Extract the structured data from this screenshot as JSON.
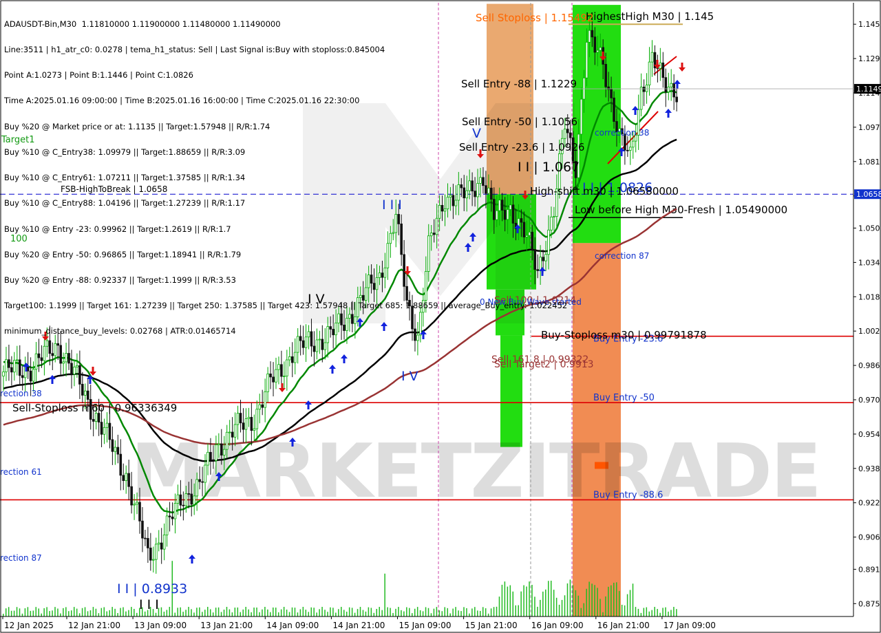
{
  "info_lines": [
    "ADAUSDT-Bin,M30  1.11810000 1.11900000 1.11480000 1.11490000",
    "Line:3511 | h1_atr_c0: 0.0278 | tema_h1_status: Sell | Last Signal is:Buy with stoploss:0.845004",
    "Point A:1.0273 | Point B:1.1446 | Point C:1.0826",
    "Time A:2025.01.16 09:00:00 | Time B:2025.01.16 16:00:00 | Time C:2025.01.16 22:30:00",
    "Buy %20 @ Market price or at: 1.1135 || Target:1.57948 || R/R:1.74",
    "Buy %10 @ C_Entry38: 1.09979 || Target:1.88659 || R/R:3.09",
    "Buy %10 @ C_Entry61: 1.07211 || Target:1.37585 || R/R:1.34",
    "Buy %10 @ C_Entry88: 1.04196 || Target:1.27239 || R/R:1.17",
    "Buy %10 @ Entry -23: 0.99962 || Target:1.2619 || R/R:1.7",
    "Buy %20 @ Entry -50: 0.96865 || Target:1.18941 || R/R:1.79",
    "Buy %20 @ Entry -88: 0.92337 || Target:1.1999 || R/R:3.53",
    "Target100: 1.1999 || Target 161: 1.27239 || Target 250: 1.37585 || Target 423: 1.57948 || Target 685: 1.88659 || average_Buy_entry: 1.022452",
    "minimum_distance_buy_levels: 0.02768 | ATR:0.01465714"
  ],
  "watermark": "MARKETZITRADE",
  "colors": {
    "up_candle": "#00aa00",
    "down_candle": "#111111",
    "ema_green": "#008800",
    "ema_black": "#000000",
    "ema_brown": "#993333",
    "line_red": "#dd0000",
    "fsb_blue": "#0000cc",
    "zone_green": "#22dd11",
    "zone_orange": "#f08040",
    "text_orange": "#ff6600"
  },
  "chart_data": {
    "type": "candlestick",
    "symbol": "ADAUSDT-Bin",
    "timeframe": "M30",
    "ylim": [
      0.869,
      1.155
    ],
    "yticks": [
      1.145,
      1.129,
      1.113,
      1.097,
      1.081,
      1.065,
      1.05,
      1.034,
      1.018,
      1.002,
      0.986,
      0.97,
      0.954,
      0.938,
      0.922,
      0.906,
      0.891,
      0.875
    ],
    "ytick_labels": [
      "1.145",
      "1.129",
      "1.114",
      "1.097",
      "1.081",
      "1.065",
      "1.050",
      "1.034",
      "1.018",
      "1.002",
      "0.986",
      "0.970",
      "0.954",
      "0.938",
      "0.922",
      "0.906",
      "0.891",
      "0.875"
    ],
    "current_price": 1.1149,
    "current_price_label": "1.1149",
    "fsb_price_label": "1.0658",
    "x_labels": [
      "12 Jan 2025",
      "12 Jan 21:00",
      "13 Jan 09:00",
      "13 Jan 21:00",
      "14 Jan 09:00",
      "14 Jan 21:00",
      "15 Jan 09:00",
      "15 Jan 21:00",
      "16 Jan 09:00",
      "16 Jan 21:00",
      "17 Jan 09:00"
    ],
    "horizontal_lines": [
      {
        "name": "FSB-HighToBreak",
        "price": 1.0658,
        "style": "dashed-blue",
        "label": "FSB-HighToBreak | 1.0658"
      },
      {
        "name": "Buy Entry -23.6",
        "price": 0.9996,
        "style": "red",
        "label": "Buy Entry -23.6"
      },
      {
        "name": "Buy Entry -50",
        "price": 0.96865,
        "style": "red",
        "label": "Buy Entry -50"
      },
      {
        "name": "Buy Entry -88.6",
        "price": 0.92337,
        "style": "red",
        "label": "Buy Entry -88.6"
      },
      {
        "name": "HighestHigh M30",
        "price": 1.145,
        "style": "olive",
        "label": "HighestHigh   M30 | 1.145"
      },
      {
        "name": "Low before High M30-Fresh",
        "price": 1.0549,
        "style": "black",
        "label": "Low before High   M30-Fresh | 1.05490000"
      }
    ],
    "annotations": [
      "Sell Stoploss | 1.15492",
      "Sell Entry -88 | 1.1229",
      "Sell Entry -50 | 1.1056",
      "Sell Entry -23.6 | 1.0926",
      "I I | 1.067",
      "I I | 1.0826",
      "High-shift m30 | 1.06580000",
      "correction 38",
      "correction 87",
      "Buy-Stoploss m30 | 0.99791878",
      "Sell 100 | 1.0214",
      "0 New Buy Wave started",
      "Sell 161.8 | 0.99322",
      "Sell Target2 | 0.9913",
      "Sell-Stoploss m60 | 0.96336349",
      "I I | 0.8933",
      "I I I",
      "I V",
      "V",
      "Target1",
      "100",
      "rection 38",
      "rection 61",
      "rection 87"
    ]
  }
}
